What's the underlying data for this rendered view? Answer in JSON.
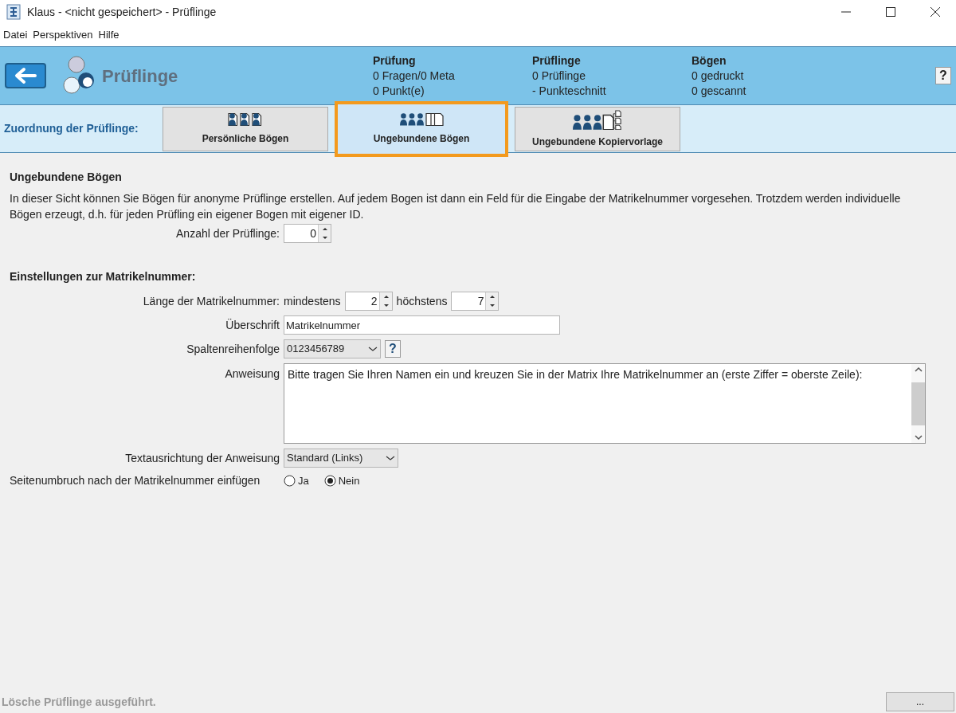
{
  "window": {
    "title": "Klaus - <nicht gespeichert> - Prüflinge"
  },
  "menu": [
    "Datei",
    "Perspektiven",
    "Hilfe"
  ],
  "header": {
    "title": "Prüflinge",
    "stats": [
      {
        "heading": "Prüfung",
        "lines": [
          "0 Fragen/0 Meta",
          "0 Punkt(e)"
        ]
      },
      {
        "heading": "Prüflinge",
        "lines": [
          "0 Prüflinge",
          "- Punkteschnitt"
        ]
      },
      {
        "heading": "Bögen",
        "lines": [
          "0 gedruckt",
          "0 gescannt"
        ]
      }
    ],
    "help": "?"
  },
  "assignment": {
    "label": "Zuordnung der Prüflinge:",
    "tabs": [
      {
        "label": "Persönliche Bögen",
        "kind": "personal",
        "selected": false
      },
      {
        "label": "Ungebundene Bögen",
        "kind": "unbound",
        "selected": true
      },
      {
        "label": "Ungebundene Kopiervorlage",
        "kind": "template",
        "selected": false
      }
    ]
  },
  "section": {
    "title": "Ungebundene Bögen",
    "description": "In dieser Sicht können Sie Bögen für anonyme Prüflinge erstellen. Auf jedem Bogen ist dann ein Feld für die Eingabe der Matrikelnummer vorgesehen. Trotzdem werden individuelle Bögen erzeugt, d.h. für jeden Prüfling ein eigener Bogen mit eigener ID.",
    "count_label": "Anzahl der Prüflinge:",
    "count_value": "0"
  },
  "settings": {
    "title": "Einstellungen zur Matrikelnummer:",
    "length": {
      "label": "Länge der Matrikelnummer:",
      "min_label": "mindestens",
      "min_value": "2",
      "max_label": "höchstens",
      "max_value": "7"
    },
    "heading": {
      "label": "Überschrift",
      "value": "Matrikelnummer"
    },
    "column_order": {
      "label": "Spaltenreihenfolge",
      "value": "0123456789",
      "help": "?"
    },
    "instruction": {
      "label": "Anweisung",
      "value": "Bitte tragen Sie Ihren Namen ein und kreuzen Sie in der Matrix Ihre Matrikelnummer an (erste Ziffer = oberste Zeile):"
    },
    "alignment": {
      "label": "Textausrichtung der Anweisung",
      "value": "Standard (Links)"
    },
    "page_break": {
      "label": "Seitenumbruch nach der Matrikelnummer einfügen",
      "options": [
        {
          "label": "Ja",
          "selected": false
        },
        {
          "label": "Nein",
          "selected": true
        }
      ]
    }
  },
  "status_bar": {
    "message": "Lösche Prüflinge ausgeführt.",
    "button": "..."
  }
}
